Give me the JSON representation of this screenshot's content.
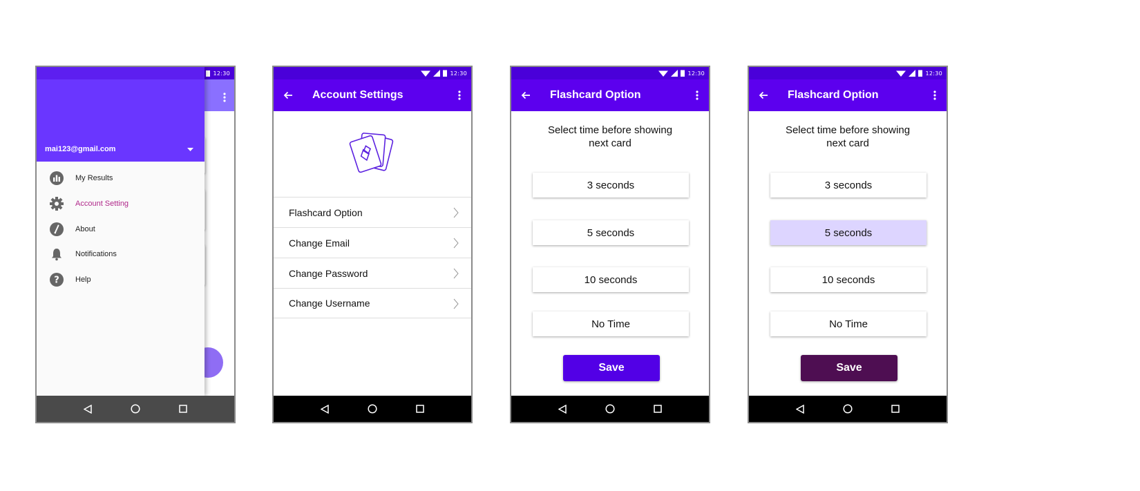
{
  "status": {
    "time": "12:30"
  },
  "screen1": {
    "drawer": {
      "email": "mai123@gmail.com",
      "items": [
        {
          "label": "My Results",
          "icon": "chart-icon"
        },
        {
          "label": "Account Setting",
          "icon": "gear-icon",
          "active": true
        },
        {
          "label": "About",
          "icon": "info-icon"
        },
        {
          "label": "Notifications",
          "icon": "bell-icon"
        },
        {
          "label": "Help",
          "icon": "help-icon"
        }
      ]
    }
  },
  "screen2": {
    "title": "Account Settings",
    "items": [
      {
        "label": "Flashcard Option"
      },
      {
        "label": "Change Email"
      },
      {
        "label": "Change Password"
      },
      {
        "label": "Change Username"
      }
    ]
  },
  "screen3": {
    "title": "Flashcard Option",
    "prompt_line1": "Select time before showing",
    "prompt_line2": "next card",
    "options": [
      "3 seconds",
      "5 seconds",
      "10 seconds",
      "No Time"
    ],
    "selected_index": null,
    "save_label": "Save",
    "save_color": "#5200e6"
  },
  "screen4": {
    "title": "Flashcard Option",
    "prompt_line1": "Select time before showing",
    "prompt_line2": "next card",
    "options": [
      "3 seconds",
      "5 seconds",
      "10 seconds",
      "No Time"
    ],
    "selected_index": 1,
    "save_label": "Save",
    "save_color": "#4e0e52"
  },
  "colors": {
    "primary": "#5c00ee",
    "status": "#4a00d9",
    "selected_option": "#ddd5ff",
    "active_drawer_text": "#b0288a"
  }
}
